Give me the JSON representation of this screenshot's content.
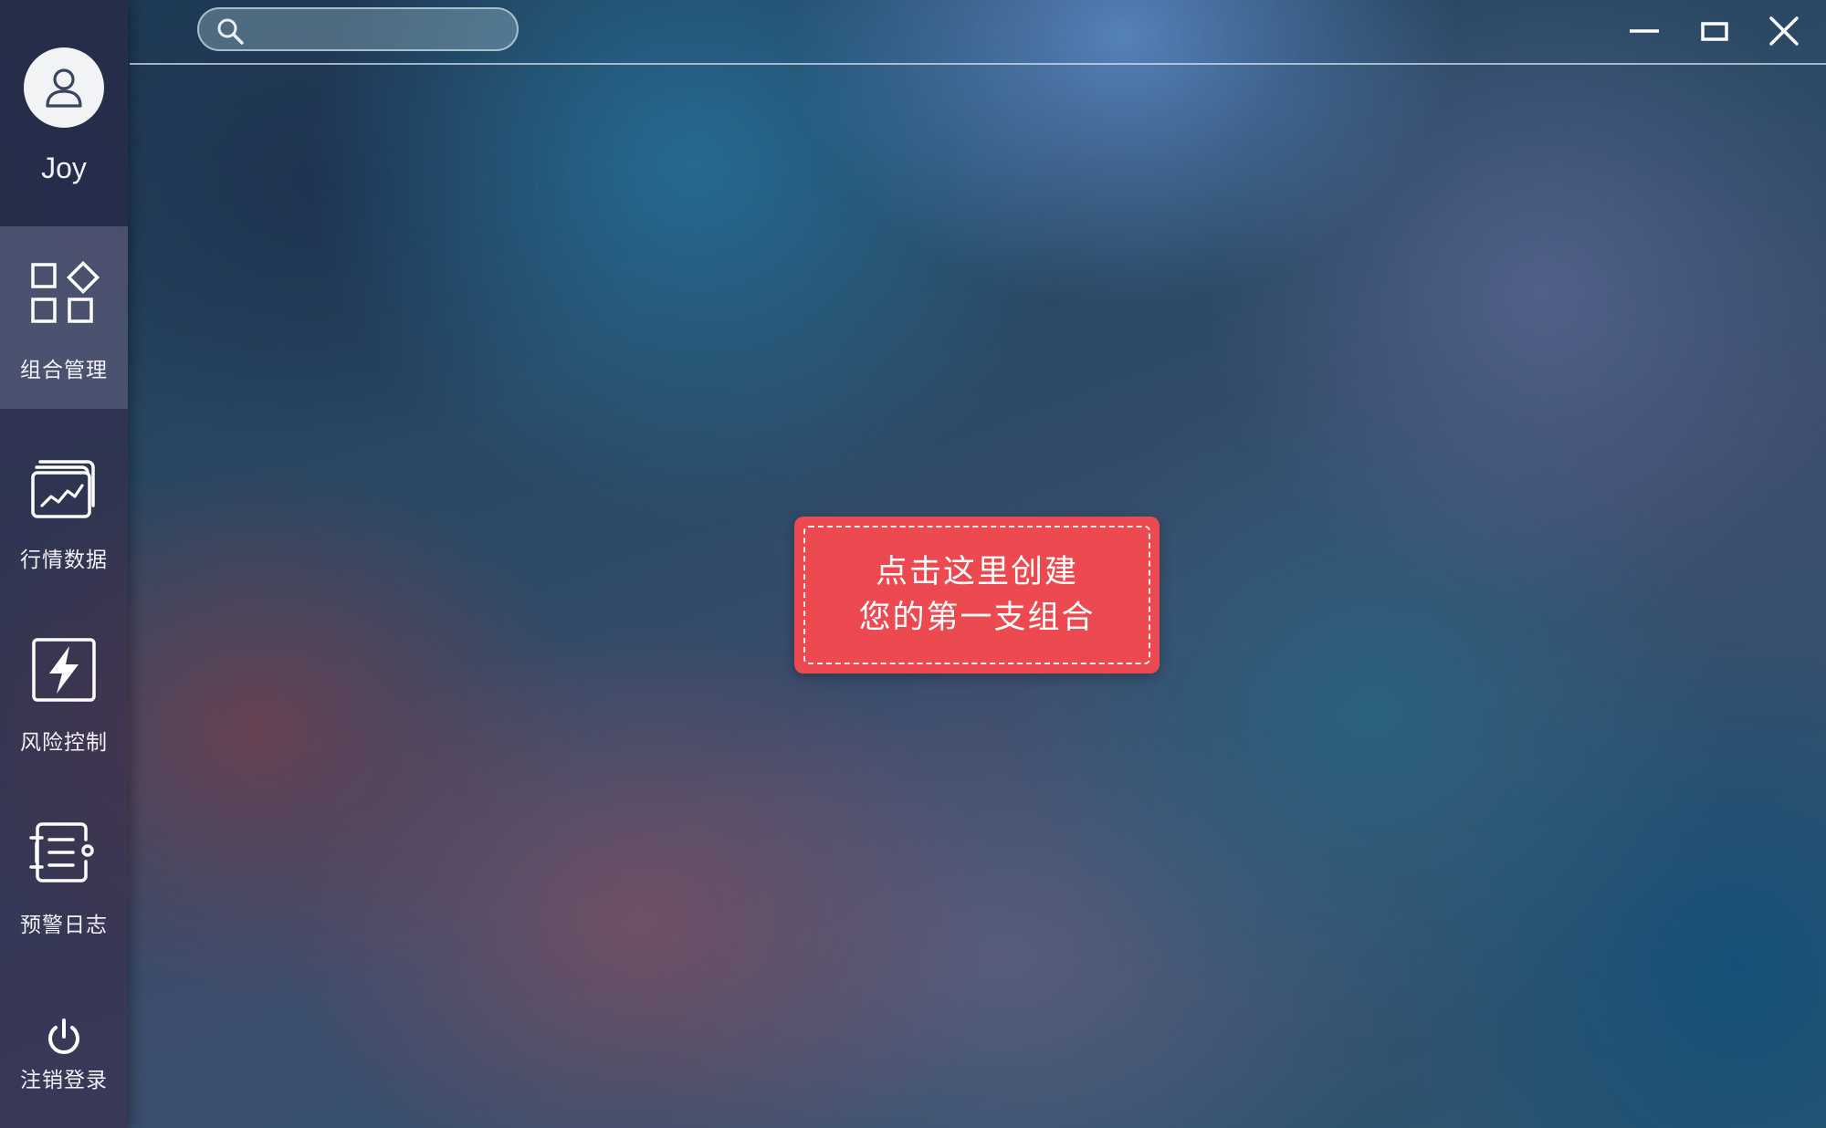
{
  "user": {
    "name": "Joy",
    "avatar_icon": "user-icon"
  },
  "sidebar": {
    "items": [
      {
        "label": "组合管理",
        "icon": "grid-shapes-icon",
        "active": true
      },
      {
        "label": "行情数据",
        "icon": "market-chart-icon",
        "active": false
      },
      {
        "label": "风险控制",
        "icon": "lightning-icon",
        "active": false
      },
      {
        "label": "预警日志",
        "icon": "log-list-icon",
        "active": false
      }
    ],
    "logout": {
      "label": "注销登录",
      "icon": "power-icon"
    }
  },
  "search": {
    "placeholder": "",
    "value": ""
  },
  "window_controls": {
    "minimize_icon": "minimize-icon",
    "maximize_icon": "maximize-icon",
    "close_icon": "close-icon"
  },
  "main": {
    "create_prompt": {
      "line1": "点击这里创建",
      "line2": "您的第一支组合"
    }
  },
  "colors": {
    "cta_background": "#ec4a50",
    "sidebar_active": "#6e7896",
    "text_light": "#f2f2f6"
  }
}
